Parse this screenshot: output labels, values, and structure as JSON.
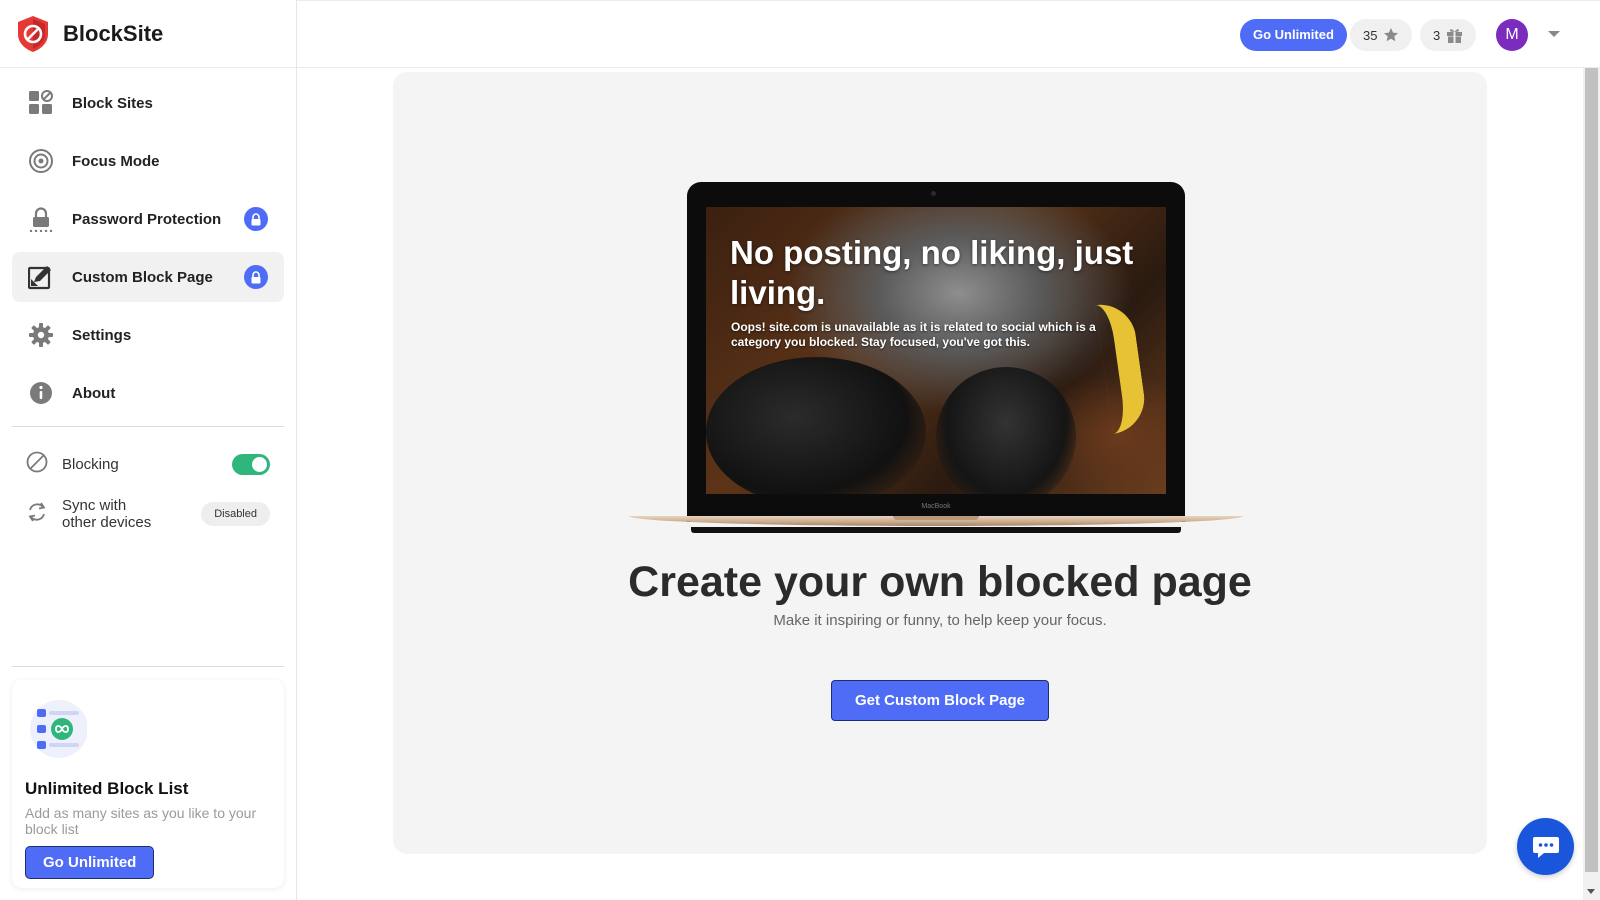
{
  "brand": {
    "name": "BlockSite"
  },
  "sidebar": {
    "items": [
      {
        "label": "Block Sites",
        "icon": "grid-block-icon",
        "active": false,
        "locked": false
      },
      {
        "label": "Focus Mode",
        "icon": "target-icon",
        "active": false,
        "locked": false
      },
      {
        "label": "Password Protection",
        "icon": "padlock-icon",
        "active": false,
        "locked": true
      },
      {
        "label": "Custom Block Page",
        "icon": "edit-page-icon",
        "active": true,
        "locked": true
      },
      {
        "label": "Settings",
        "icon": "gear-icon",
        "active": false,
        "locked": false
      },
      {
        "label": "About",
        "icon": "info-icon",
        "active": false,
        "locked": false
      }
    ],
    "blocking": {
      "label": "Blocking",
      "enabled": true
    },
    "sync": {
      "label_line1": "Sync with",
      "label_line2": "other devices",
      "status": "Disabled"
    },
    "promo": {
      "title": "Unlimited Block List",
      "description": "Add as many sites as you like to your block list",
      "button": "Go Unlimited"
    }
  },
  "topbar": {
    "go_unlimited": "Go Unlimited",
    "stars_count": "35",
    "gifts_count": "3",
    "avatar_initial": "M"
  },
  "main": {
    "preview": {
      "headline": "No posting, no liking, just living.",
      "subtext": "Oops! site.com is unavailable as it is related to social which is a category you blocked. Stay focused, you've got this.",
      "device_label": "MacBook"
    },
    "heading": "Create your own blocked page",
    "subheading": "Make it inspiring or funny, to help keep your focus.",
    "cta": "Get Custom Block Page"
  },
  "colors": {
    "accent": "#4f6cf7",
    "toggle_on": "#2fb67c",
    "avatar": "#7b2cbf",
    "chat": "#1a56db",
    "logo": "#e53935"
  }
}
